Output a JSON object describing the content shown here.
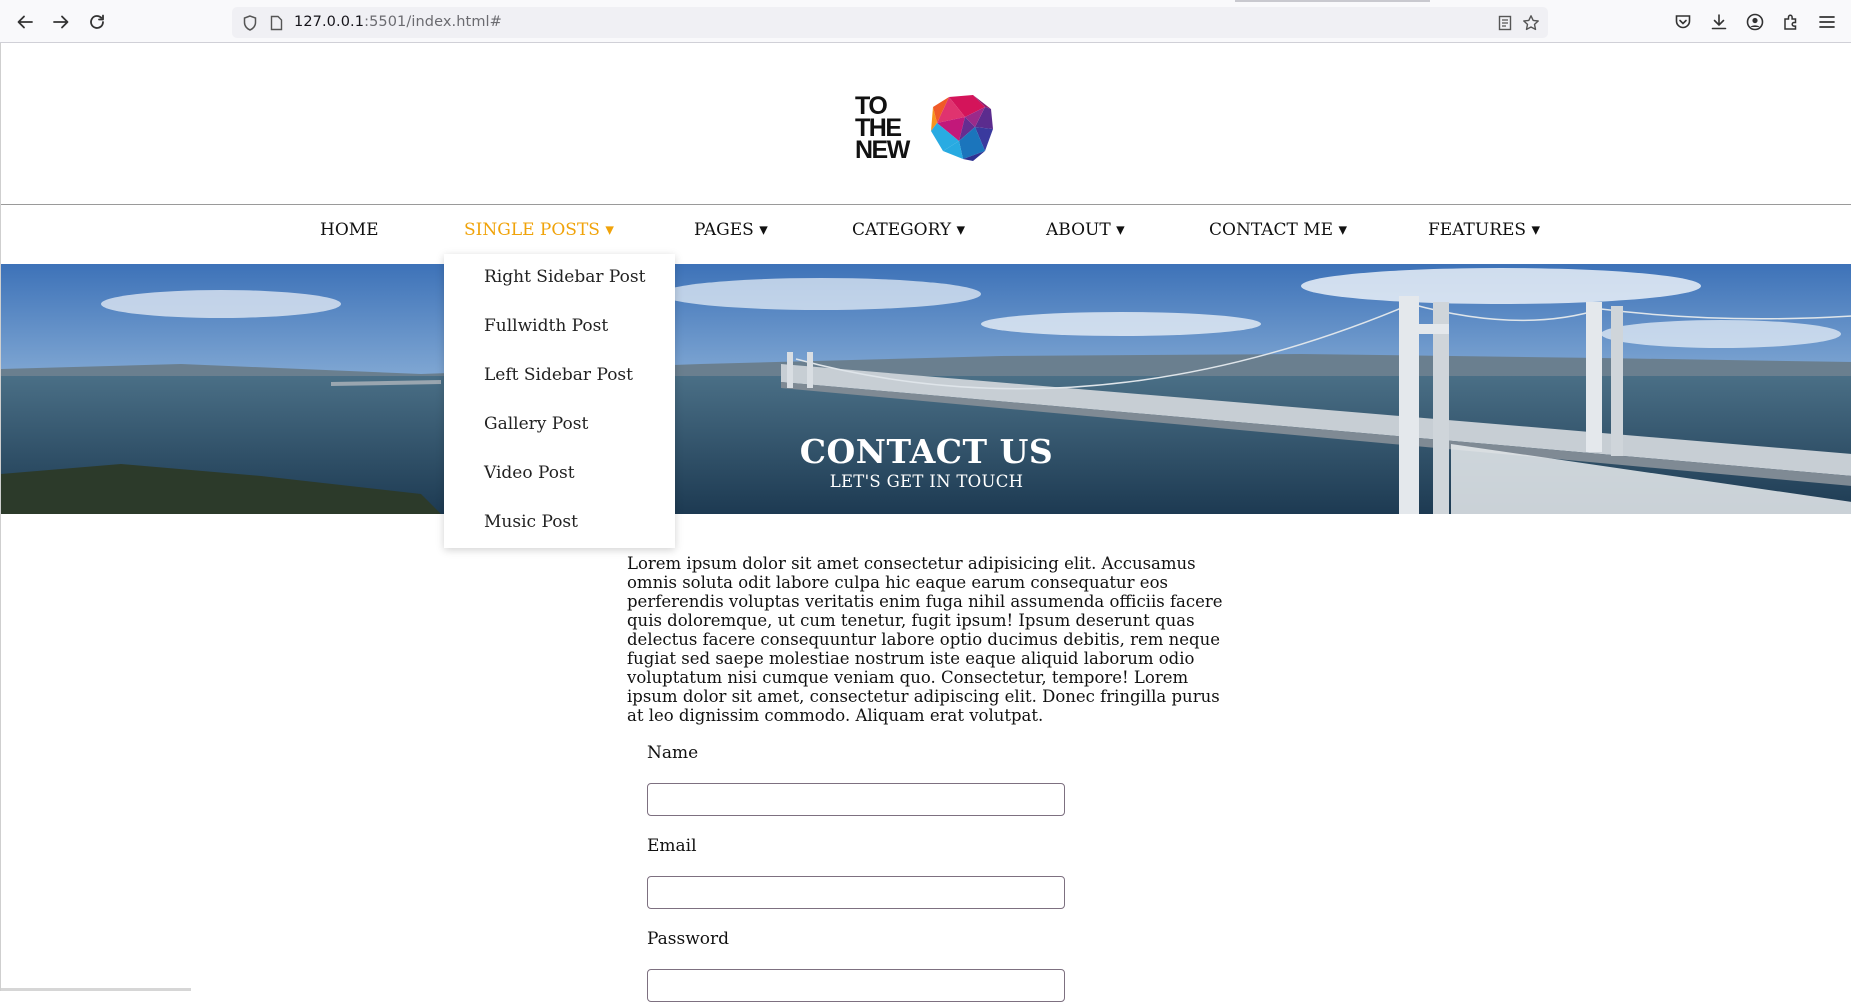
{
  "browser": {
    "url_host": "127.0.0.1",
    "url_path": ":5501/index.html#",
    "icons": {
      "back": "back-arrow-icon",
      "forward": "forward-arrow-icon",
      "reload": "reload-icon",
      "shield": "shield-icon",
      "page": "page-icon",
      "reader": "reader-view-icon",
      "bookmark": "star-icon",
      "pocket": "pocket-icon",
      "downloads": "download-icon",
      "account": "account-icon",
      "extensions": "extensions-icon",
      "menu": "hamburger-menu-icon"
    }
  },
  "logo": {
    "line1": "TO",
    "line2": "THE",
    "line3": "NEW"
  },
  "nav": {
    "items": [
      {
        "label": "HOME"
      },
      {
        "label": "SINGLE POSTS ▾"
      },
      {
        "label": "PAGES ▾"
      },
      {
        "label": "CATEGORY ▾"
      },
      {
        "label": "ABOUT ▾"
      },
      {
        "label": "CONTACT ME ▾"
      },
      {
        "label": "FEATURES ▾"
      }
    ],
    "active_color": "#f0a30a"
  },
  "dropdown": {
    "items": [
      {
        "label": "Right Sidebar Post"
      },
      {
        "label": "Fullwidth Post"
      },
      {
        "label": "Left Sidebar Post"
      },
      {
        "label": "Gallery Post"
      },
      {
        "label": "Video Post"
      },
      {
        "label": "Music Post"
      }
    ]
  },
  "hero": {
    "title": "CONTACT US",
    "subtitle": "LET'S GET IN TOUCH"
  },
  "content": {
    "intro": "Lorem ipsum dolor sit amet consectetur adipisicing elit. Accusamus omnis soluta odit labore culpa hic eaque earum consequatur eos perferendis voluptas veritatis enim fuga nihil assumenda officiis facere quis doloremque, ut cum tenetur, fugit ipsum! Ipsum deserunt quas delectus facere consequuntur labore optio ducimus debitis, rem neque fugiat sed saepe molestiae nostrum iste eaque aliquid laborum odio voluptatum nisi cumque veniam quo. Consectetur, tempore! Lorem ipsum dolor sit amet, consectetur adipiscing elit. Donec fringilla purus at leo dignissim commodo. Aliquam erat volutpat."
  },
  "form": {
    "name_label": "Name",
    "name_value": "",
    "email_label": "Email",
    "email_value": "",
    "password_label": "Password",
    "password_value": ""
  }
}
